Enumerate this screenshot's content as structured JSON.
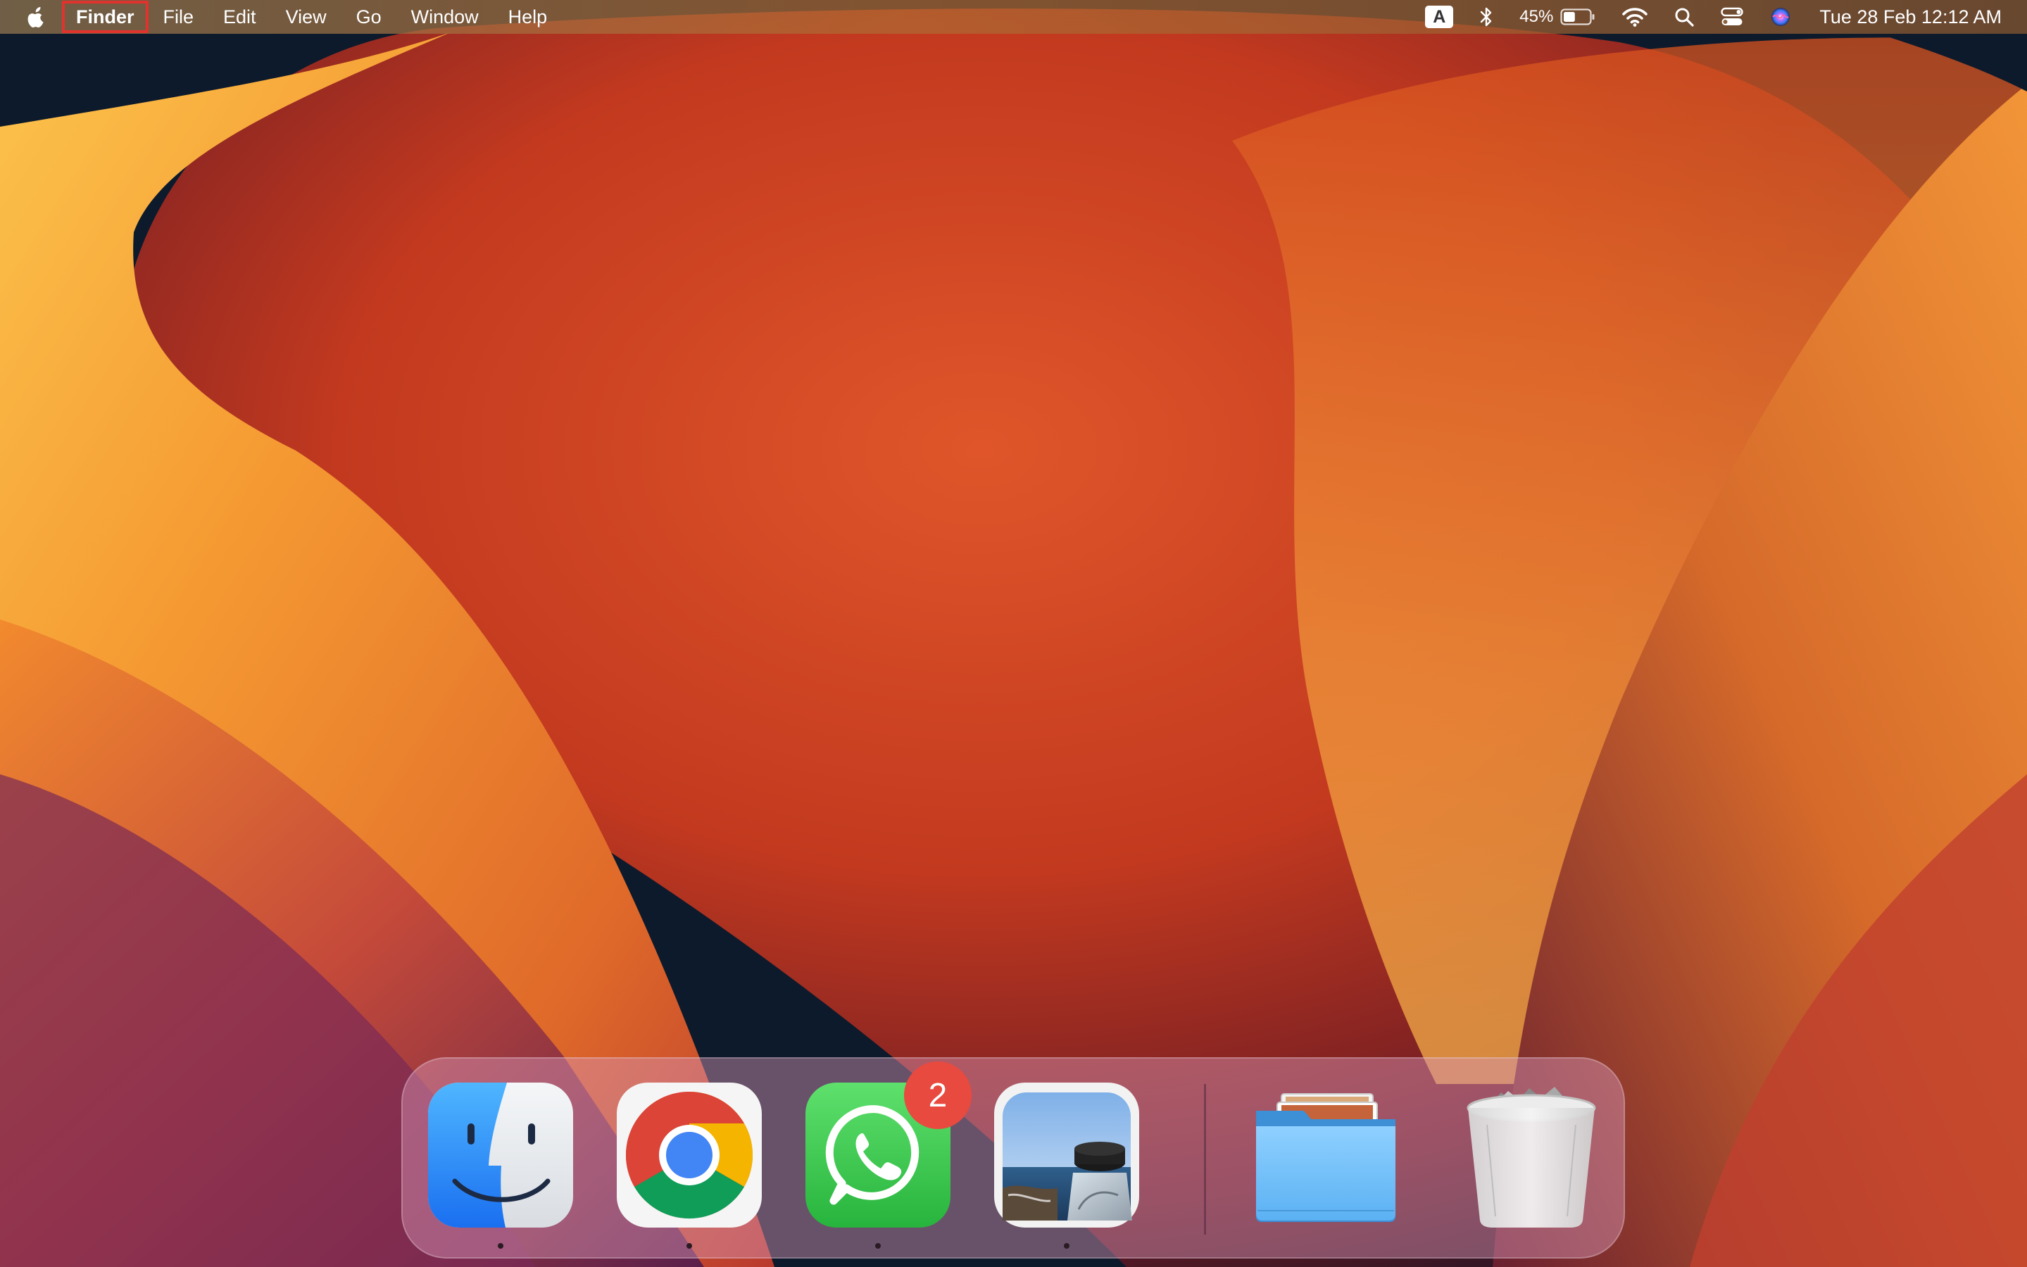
{
  "menubar": {
    "apple_icon": "apple-logo-icon",
    "app_name": "Finder",
    "menus": [
      "File",
      "Edit",
      "View",
      "Go",
      "Window",
      "Help"
    ],
    "status": {
      "input_source": "A",
      "bluetooth_icon": "bluetooth-icon",
      "battery_percent": "45%",
      "battery_level": 0.45,
      "wifi_icon": "wifi-icon",
      "spotlight_icon": "search-icon",
      "control_center_icon": "control-center-icon",
      "siri_icon": "siri-icon",
      "clock": "Tue 28 Feb  12:12 AM"
    },
    "highlight_color": "#e0332d"
  },
  "dock": {
    "apps": [
      {
        "name": "Finder",
        "icon": "finder-icon",
        "running": true
      },
      {
        "name": "Google Chrome",
        "icon": "chrome-icon",
        "running": true
      },
      {
        "name": "WhatsApp",
        "icon": "whatsapp-icon",
        "running": true,
        "badge": "2"
      },
      {
        "name": "Preview",
        "icon": "preview-icon",
        "running": true
      }
    ],
    "folders": [
      {
        "name": "Downloads",
        "icon": "stack-folder-icon"
      },
      {
        "name": "Trash",
        "icon": "trash-icon"
      }
    ],
    "badge_color": "#e84a3f"
  },
  "wallpaper": {
    "colors": [
      "#0d1a2b",
      "#f2992e",
      "#d94a1f",
      "#7a1e28",
      "#fbc04a"
    ]
  }
}
